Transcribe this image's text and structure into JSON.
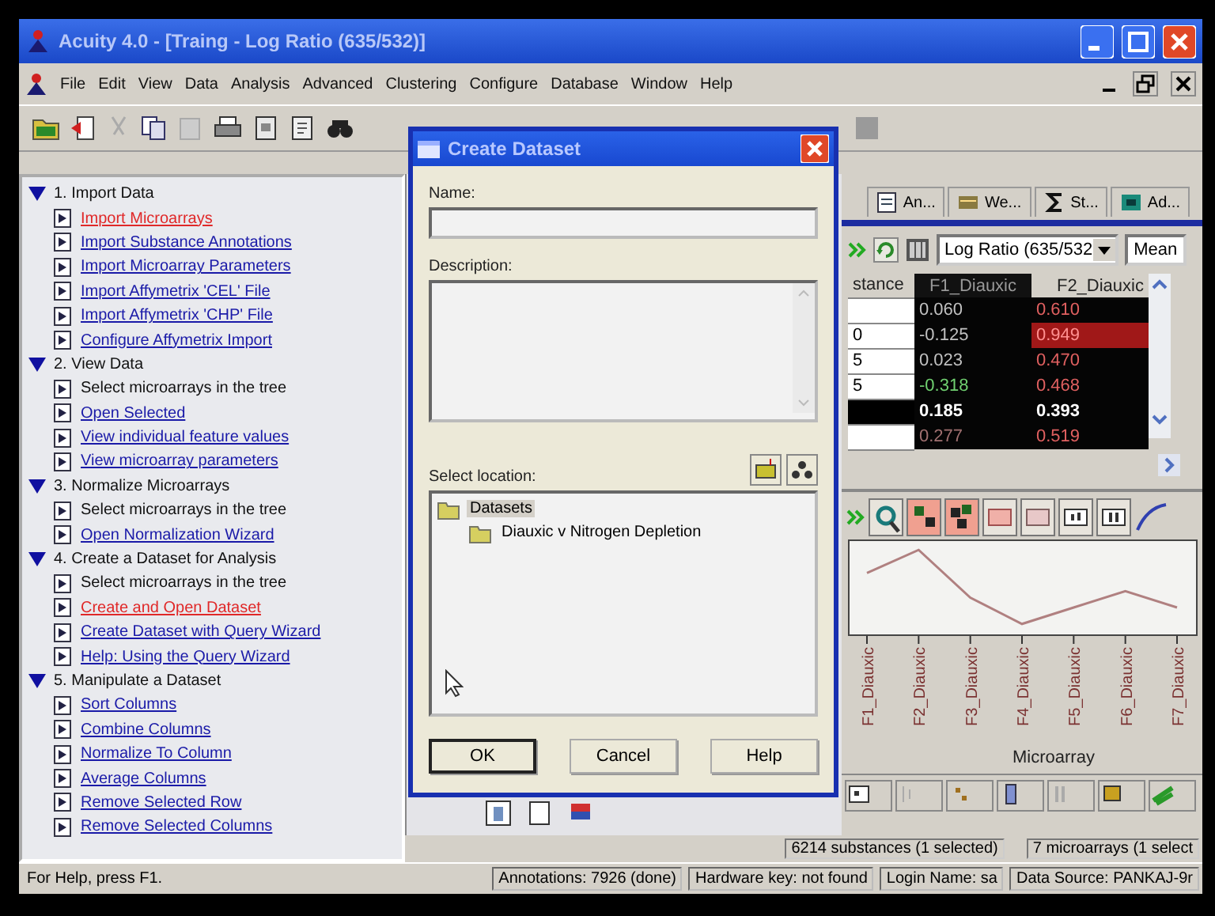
{
  "window": {
    "title": "Acuity 4.0 - [Traing - Log Ratio (635/532)]"
  },
  "menu": [
    "File",
    "Edit",
    "View",
    "Data",
    "Analysis",
    "Advanced",
    "Clustering",
    "Configure",
    "Database",
    "Window",
    "Help"
  ],
  "tasks": [
    {
      "label": "1. Import Data",
      "expanded": true,
      "children": [
        {
          "label": "Import Microarrays",
          "kind": "link",
          "active": true
        },
        {
          "label": "Import Substance Annotations",
          "kind": "link",
          "active": false
        },
        {
          "label": "Import Microarray Parameters",
          "kind": "link",
          "active": false
        },
        {
          "label": "Import Affymetrix 'CEL' File",
          "kind": "link",
          "active": false
        },
        {
          "label": "Import Affymetrix 'CHP' File",
          "kind": "link",
          "active": false
        },
        {
          "label": "Configure Affymetrix Import",
          "kind": "link",
          "active": false
        }
      ]
    },
    {
      "label": "2. View Data",
      "expanded": true,
      "children": [
        {
          "label": "Select microarrays in the tree",
          "kind": "text"
        },
        {
          "label": "Open Selected",
          "kind": "link",
          "active": false
        },
        {
          "label": "View individual feature values",
          "kind": "link",
          "active": false
        },
        {
          "label": "View microarray parameters",
          "kind": "link",
          "active": false
        }
      ]
    },
    {
      "label": "3. Normalize Microarrays",
      "expanded": true,
      "children": [
        {
          "label": "Select microarrays in the tree",
          "kind": "text"
        },
        {
          "label": "Open Normalization Wizard",
          "kind": "link",
          "active": false
        }
      ]
    },
    {
      "label": "4. Create a Dataset for Analysis",
      "expanded": true,
      "children": [
        {
          "label": "Select microarrays in the tree",
          "kind": "text"
        },
        {
          "label": "Create and Open Dataset",
          "kind": "link",
          "active": true
        },
        {
          "label": "Create Dataset with Query Wizard",
          "kind": "link",
          "active": false
        },
        {
          "label": "Help: Using the Query Wizard",
          "kind": "link",
          "active": false
        }
      ]
    },
    {
      "label": "5. Manipulate a Dataset",
      "expanded": true,
      "children": [
        {
          "label": "Sort Columns",
          "kind": "link",
          "active": false
        },
        {
          "label": "Combine Columns",
          "kind": "link",
          "active": false
        },
        {
          "label": "Normalize To Column",
          "kind": "link",
          "active": false
        },
        {
          "label": "Average Columns",
          "kind": "link",
          "active": false
        },
        {
          "label": "Remove Selected Row",
          "kind": "link",
          "active": false
        },
        {
          "label": "Remove Selected Columns",
          "kind": "link",
          "active": false
        }
      ]
    }
  ],
  "dialog": {
    "title": "Create Dataset",
    "name_label": "Name:",
    "description_label": "Description:",
    "location_label": "Select location:",
    "tree": [
      {
        "label": "Datasets",
        "selected": true,
        "children": [
          {
            "label": "Diauxic v Nitrogen Depletion",
            "selected": false
          }
        ]
      }
    ],
    "buttons": [
      {
        "label": "OK",
        "default": true
      },
      {
        "label": "Cancel",
        "default": false
      },
      {
        "label": "Help",
        "default": false
      }
    ]
  },
  "view_tabs": [
    "An...",
    "We...",
    "St...",
    "Ad..."
  ],
  "grid": {
    "measure": "Log Ratio (635/532",
    "statistic": "Mean",
    "columns": [
      "stance",
      "F1_Diauxic",
      "F2_Diauxic"
    ],
    "rows": [
      {
        "selected": false,
        "values": [
          {
            "text": "0.060",
            "color": "#c0c0c0",
            "highlight": false
          },
          {
            "text": "0.610",
            "color": "#e06060",
            "highlight": false
          }
        ]
      },
      {
        "id": "0",
        "selected": false,
        "values": [
          {
            "text": "-0.125",
            "color": "#c0c0c0",
            "highlight": false
          },
          {
            "text": "0.949",
            "color": "#ff9090",
            "highlight": true
          }
        ]
      },
      {
        "id": "5",
        "selected": false,
        "values": [
          {
            "text": "0.023",
            "color": "#c0c0c0",
            "highlight": false
          },
          {
            "text": "0.470",
            "color": "#e06060",
            "highlight": false
          }
        ]
      },
      {
        "id": "5",
        "selected": false,
        "values": [
          {
            "text": "-0.318",
            "color": "#70d070",
            "highlight": false
          },
          {
            "text": "0.468",
            "color": "#e06060",
            "highlight": false
          }
        ]
      },
      {
        "selected": true,
        "values": [
          {
            "text": "0.185",
            "color": "#ffffff",
            "highlight": false
          },
          {
            "text": "0.393",
            "color": "#ffffff",
            "highlight": false
          }
        ]
      },
      {
        "selected": false,
        "values": [
          {
            "text": "0.277",
            "color": "#a07070",
            "highlight": false
          },
          {
            "text": "0.519",
            "color": "#e06060",
            "highlight": false
          }
        ]
      }
    ]
  },
  "chart": {
    "x_labels": [
      "F1_Diauxic",
      "F2_Diauxic",
      "F3_Diauxic",
      "F4_Diauxic",
      "F5_Diauxic",
      "F6_Diauxic",
      "F7_Diauxic"
    ],
    "xlabel": "Microarray"
  },
  "counts": [
    "6214 substances (1 selected)",
    "7 microarrays (1 select"
  ],
  "status_bar": [
    "For Help, press F1.",
    "Annotations: 7926 (done)",
    "Hardware key: not found",
    "Login Name: sa",
    "Data Source: PANKAJ-9r"
  ]
}
